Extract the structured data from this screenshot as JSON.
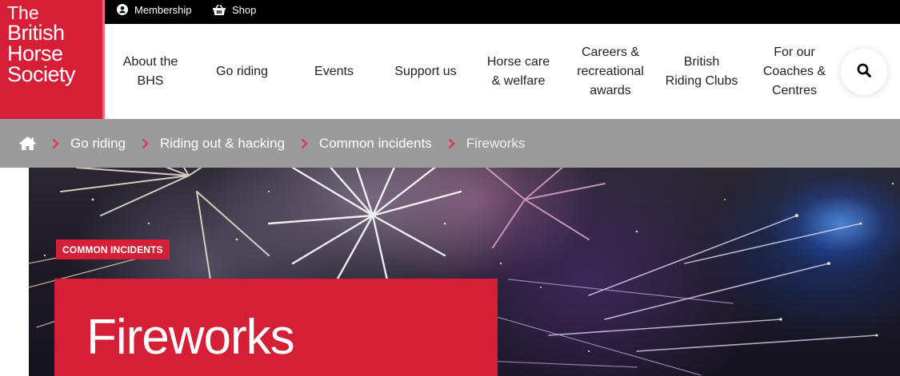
{
  "utility": {
    "membership_label": "Membership",
    "shop_label": "Shop"
  },
  "logo": {
    "line1": "The",
    "line2": "British",
    "line3": "Horse",
    "line4": "Society"
  },
  "nav": {
    "items": [
      {
        "label": "About the\nBHS"
      },
      {
        "label": "Go riding"
      },
      {
        "label": "Events"
      },
      {
        "label": "Support us"
      },
      {
        "label": "Horse care\n& welfare"
      },
      {
        "label": "Careers &\nrecreational\nawards"
      },
      {
        "label": "British\nRiding Clubs"
      },
      {
        "label": "For our\nCoaches &\nCentres"
      }
    ],
    "search_icon": "search-icon"
  },
  "breadcrumb": {
    "home_icon": "home-icon",
    "items": [
      {
        "label": "Go riding"
      },
      {
        "label": "Riding out & hacking"
      },
      {
        "label": "Common incidents"
      },
      {
        "label": "Fireworks"
      }
    ]
  },
  "hero": {
    "tag": "COMMON INCIDENTS",
    "title": "Fireworks"
  },
  "colors": {
    "brand_red": "#d41f37",
    "breadcrumb_grey": "#9b9b9b",
    "topbar_black": "#000000"
  }
}
